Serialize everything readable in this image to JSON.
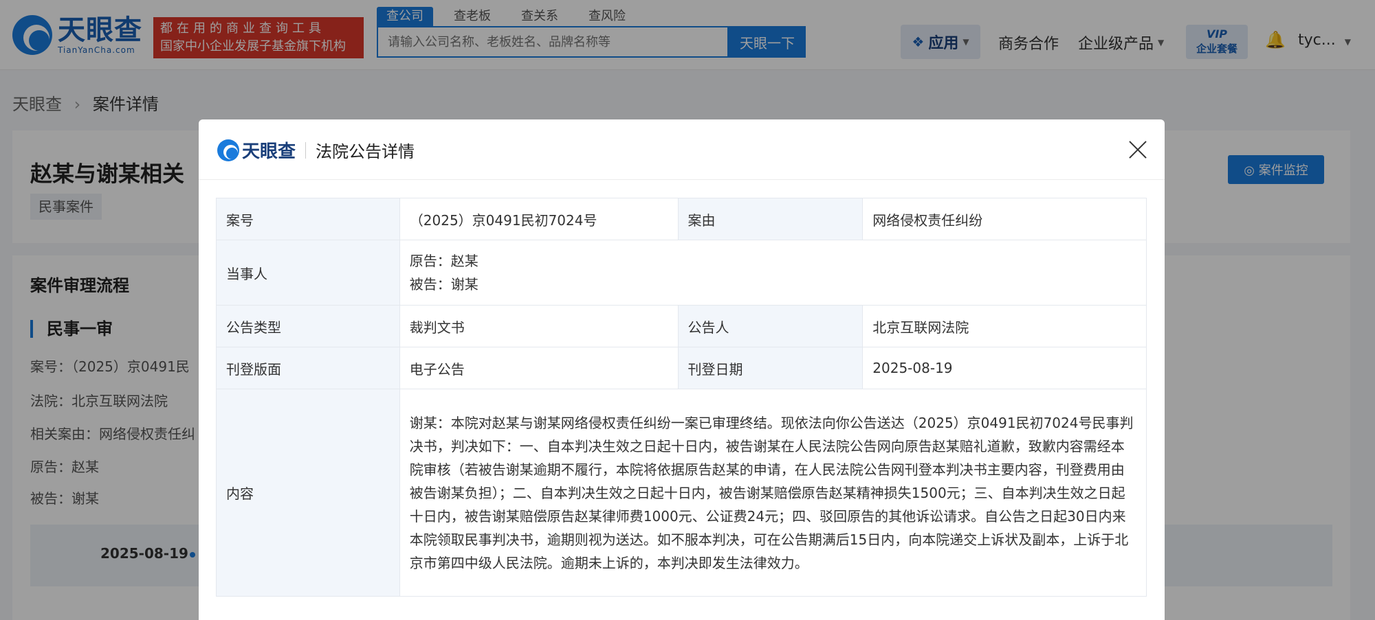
{
  "header": {
    "logo_cn": "天眼查",
    "logo_en": "TianYanCha.com",
    "slogan_line1": "都在用的商业查询工具",
    "slogan_line2": "国家中小企业发展子基金旗下机构",
    "search_tabs": [
      "查公司",
      "查老板",
      "查关系",
      "查风险"
    ],
    "search_placeholder": "请输入公司名称、老板姓名、品牌名称等",
    "search_button": "天眼一下",
    "nav_apps": "应用",
    "nav_business": "商务合作",
    "nav_enterprise": "企业级产品",
    "vip_line1": "VIP",
    "vip_line2": "企业套餐",
    "user": "tyc..."
  },
  "page": {
    "breadcrumb_home": "天眼查",
    "breadcrumb_current": "案件详情",
    "case_title": "赵某与谢某相关",
    "case_tag": "民事案件",
    "monitor_button": "案件监控",
    "flow_title": "案件审理流程",
    "stage": "民事一审",
    "info": [
      "案号：（2025）京0491民",
      "法院：北京互联网法院",
      "相关案由：网络侵权责任纠",
      "原告：赵某",
      "被告：谢某"
    ],
    "timeline_date": "2025-08-19"
  },
  "modal": {
    "logo": "天眼查",
    "title": "法院公告详情",
    "rows": {
      "case_no_label": "案号",
      "case_no_value": "（2025）京0491民初7024号",
      "cause_label": "案由",
      "cause_value": "网络侵权责任纠纷",
      "parties_label": "当事人",
      "plaintiff": "原告：赵某",
      "defendant": "被告：谢某",
      "notice_type_label": "公告类型",
      "notice_type_value": "裁判文书",
      "announcer_label": "公告人",
      "announcer_value": "北京互联网法院",
      "layout_label": "刊登版面",
      "layout_value": "电子公告",
      "pub_date_label": "刊登日期",
      "pub_date_value": "2025-08-19",
      "content_label": "内容",
      "content_value": "谢某：本院对赵某与谢某网络侵权责任纠纷一案已审理终结。现依法向你公告送达（2025）京0491民初7024号民事判决书，判决如下：一、自本判决生效之日起十日内，被告谢某在人民法院公告网向原告赵某赔礼道歉，致歉内容需经本院审核（若被告谢某逾期不履行，本院将依据原告赵某的申请，在人民法院公告网刊登本判决书主要内容，刊登费用由被告谢某负担）；二、自本判决生效之日起十日内，被告谢某赔偿原告赵某精神损失1500元；三、自本判决生效之日起十日内，被告谢某赔偿原告赵某律师费1000元、公证费24元；四、驳回原告的其他诉讼请求。自公告之日起30日内来本院领取民事判决书，逾期则视为送达。如不服本判决，可在公告期满后15日内，向本院递交上诉状及副本，上诉于北京市第四中级人民法院。逾期未上诉的，本判决即发生法律效力。"
    }
  }
}
